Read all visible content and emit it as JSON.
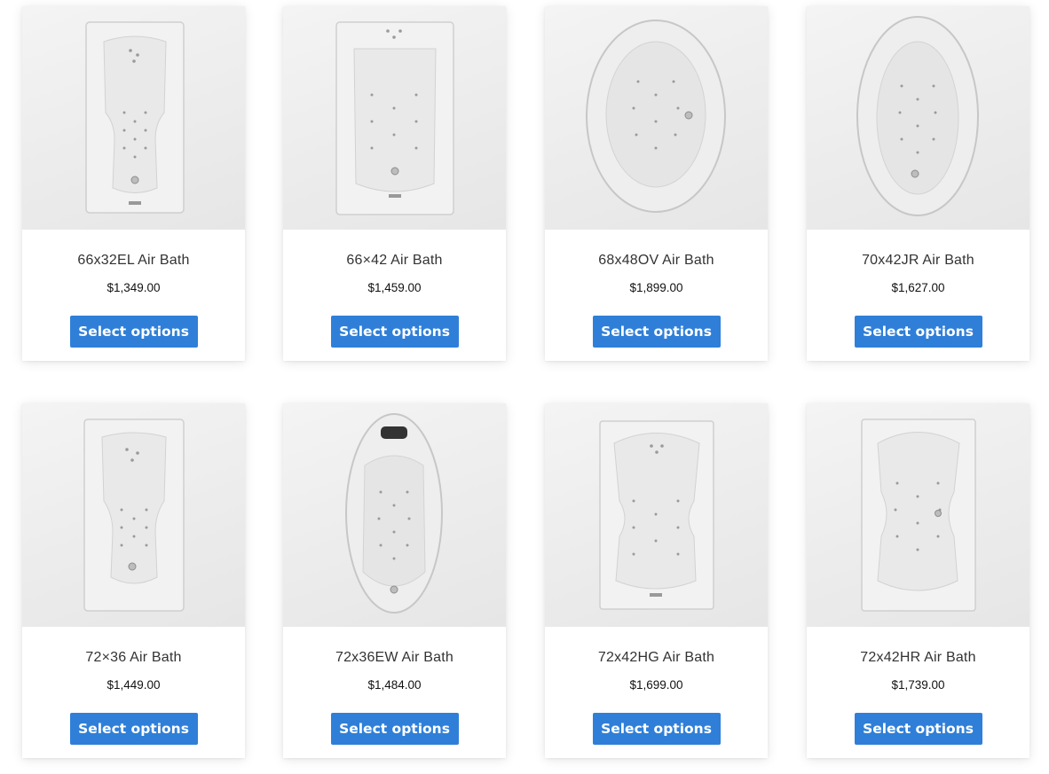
{
  "accent_color": "#2f7fd8",
  "products": [
    {
      "title": "66x32EL Air Bath",
      "price": "$1,349.00",
      "button_label": "Select options",
      "image_icon": "rectangular-tub-icon"
    },
    {
      "title": "66×42 Air Bath",
      "price": "$1,459.00",
      "button_label": "Select options",
      "image_icon": "rectangular-tub-icon"
    },
    {
      "title": "68x48OV Air Bath",
      "price": "$1,899.00",
      "button_label": "Select options",
      "image_icon": "oval-tub-icon"
    },
    {
      "title": "70x42JR Air Bath",
      "price": "$1,627.00",
      "button_label": "Select options",
      "image_icon": "oval-tub-icon"
    },
    {
      "title": "72×36 Air Bath",
      "price": "$1,449.00",
      "button_label": "Select options",
      "image_icon": "rectangular-tub-icon"
    },
    {
      "title": "72x36EW Air Bath",
      "price": "$1,484.00",
      "button_label": "Select options",
      "image_icon": "freestanding-tub-icon"
    },
    {
      "title": "72x42HG Air Bath",
      "price": "$1,699.00",
      "button_label": "Select options",
      "image_icon": "rectangular-tub-icon"
    },
    {
      "title": "72x42HR Air Bath",
      "price": "$1,739.00",
      "button_label": "Select options",
      "image_icon": "rectangular-tub-icon"
    }
  ]
}
